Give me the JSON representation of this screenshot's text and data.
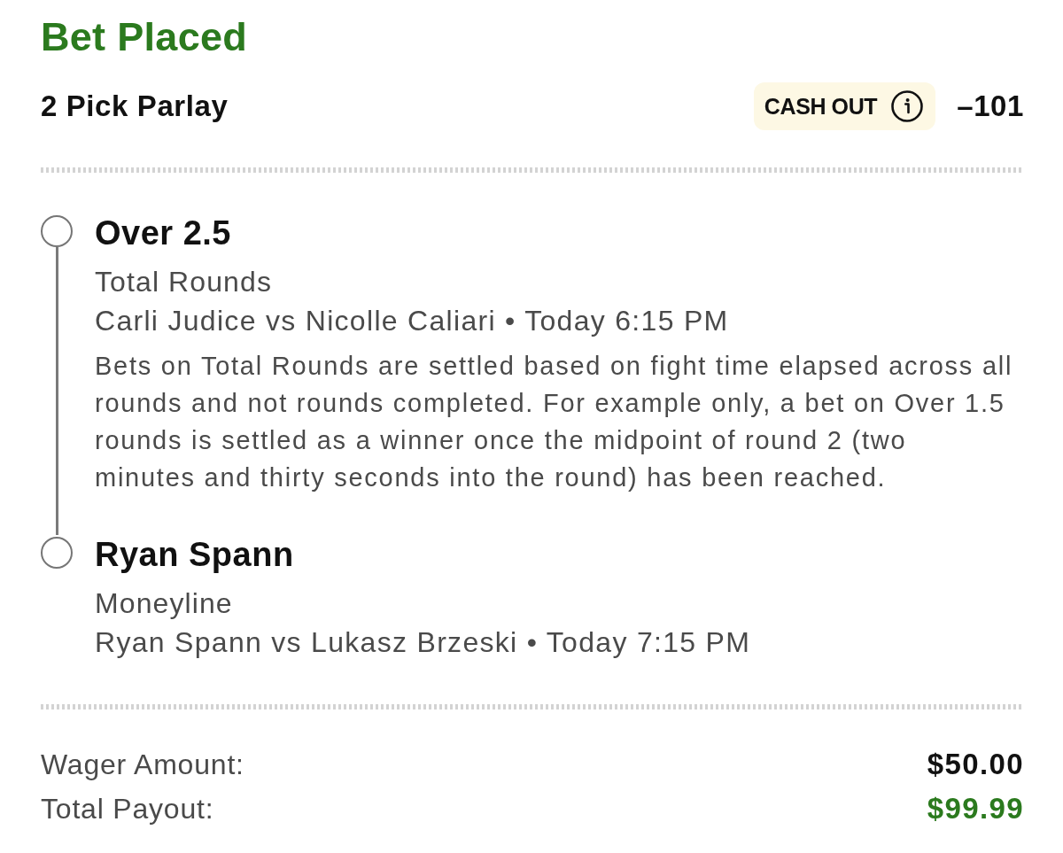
{
  "header": {
    "title": "Bet Placed",
    "bet_type": "2 Pick Parlay",
    "cash_out": {
      "label": "CASH OUT"
    },
    "odds": "–101"
  },
  "legs": [
    {
      "selection": "Over 2.5",
      "market": "Total Rounds",
      "event": "Carli Judice vs Nicolle Caliari • Today 6:15 PM",
      "note": "Bets on Total Rounds are settled based on fight time elapsed across all rounds and not rounds completed. For example only, a bet on Over 1.5 rounds is settled as a winner once the midpoint of round 2 (two minutes and thirty seconds into the round) has been reached."
    },
    {
      "selection": "Ryan Spann",
      "market": "Moneyline",
      "event": "Ryan Spann vs Lukasz Brzeski • Today 7:15 PM"
    }
  ],
  "summary": [
    {
      "label": "Wager Amount:",
      "value": "$50.00",
      "highlighted": false
    },
    {
      "label": "Total Payout:",
      "value": "$99.99",
      "highlighted": true
    }
  ]
}
